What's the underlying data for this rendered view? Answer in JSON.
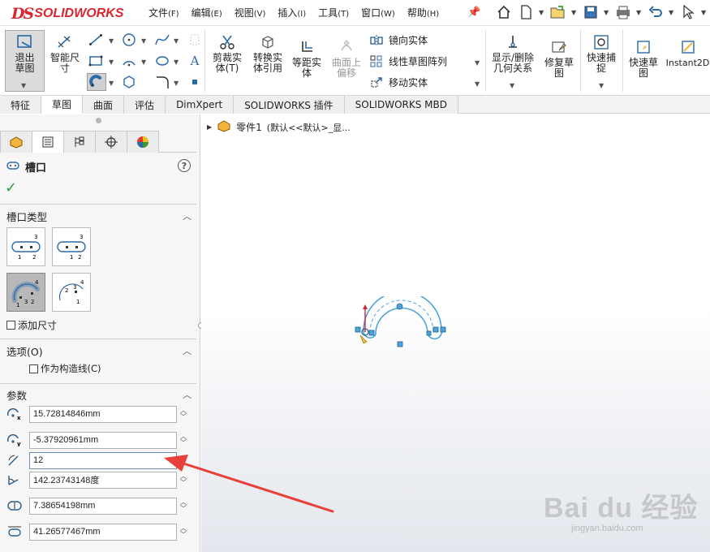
{
  "app": {
    "brand_prefix": "DS",
    "brand_name": "SOLIDWORKS"
  },
  "menu": [
    {
      "label": "文件",
      "key": "(F)"
    },
    {
      "label": "编辑",
      "key": "(E)"
    },
    {
      "label": "视图",
      "key": "(V)"
    },
    {
      "label": "插入",
      "key": "(I)"
    },
    {
      "label": "工具",
      "key": "(T)"
    },
    {
      "label": "窗口",
      "key": "(W)"
    },
    {
      "label": "帮助",
      "key": "(H)"
    }
  ],
  "toolbar": {
    "exit_sketch": "退出草图",
    "smart_dimension": "智能尺寸",
    "trim_entities": "剪裁实体(T)",
    "convert_entities": "转换实体引用",
    "offset_entities": "等距实体",
    "offset_on_surface": "曲面上偏移",
    "mirror_entities": "镜向实体",
    "linear_pattern": "线性草图阵列",
    "move_entities": "移动实体",
    "display_relations": "显示/删除几何关系",
    "repair_sketch": "修复草图",
    "quick_snaps": "快速捕捉",
    "rapid_sketch": "快速草图",
    "instant2d": "Instant2D"
  },
  "tabs": [
    "特征",
    "草图",
    "曲面",
    "评估",
    "DimXpert",
    "SOLIDWORKS 插件",
    "SOLIDWORKS MBD"
  ],
  "active_tab": "草图",
  "tree": {
    "part": "零件1",
    "config": "(默认<<默认>_显..."
  },
  "property_manager": {
    "title": "槽口",
    "slot_type_header": "槽口类型",
    "add_dimensions": "添加尺寸",
    "options_header": "选项(O)",
    "construction": "作为构造线(C)",
    "params_header": "参数",
    "params": {
      "center_x": "15.72814846mm",
      "center_y": "-5.37920961mm",
      "radius": "12",
      "angle": "142.23743148度",
      "width": "7.38654198mm",
      "length": "41.26577467mm"
    }
  },
  "watermark": {
    "brand": "Bai du 经验",
    "url": "jingyan.baidu.com"
  },
  "colors": {
    "accent": "#2b6aa8",
    "brand": "#d9262e",
    "arrow": "#e8413a",
    "sketch": "#4ea3d9"
  }
}
